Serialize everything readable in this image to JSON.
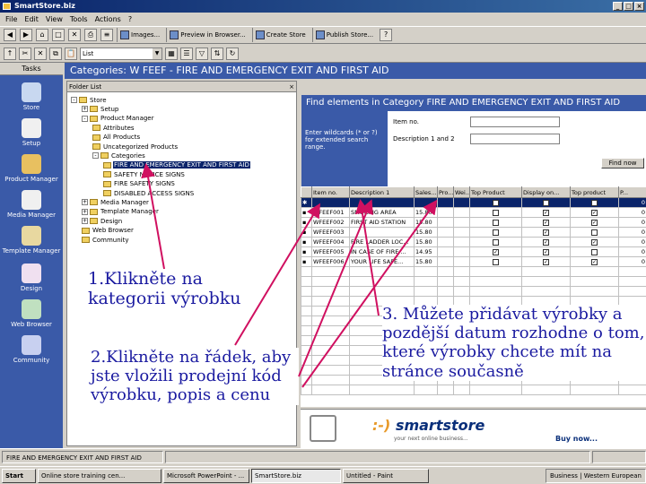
{
  "window": {
    "title": "SmartStore.biz",
    "buttons": [
      "_",
      "□",
      "×"
    ]
  },
  "menu": [
    "File",
    "Edit",
    "View",
    "Tools",
    "Actions",
    "?"
  ],
  "toolbar1": [
    {
      "label": "Images...",
      "icon": "images-icon"
    },
    {
      "label": "Preview in Browser...",
      "icon": "preview-icon"
    },
    {
      "label": "Create Store",
      "icon": "create-store-icon"
    },
    {
      "label": "Publish Store...",
      "icon": "publish-icon"
    }
  ],
  "toolbar2": {
    "combo_value": "List"
  },
  "tasks": {
    "header": "Tasks",
    "items": [
      {
        "label": "Store",
        "color": "#c8d8f0"
      },
      {
        "label": "Setup",
        "color": "#f0f0f0"
      },
      {
        "label": "Product Manager",
        "color": "#e8c060"
      },
      {
        "label": "Media Manager",
        "color": "#f0f0f0"
      },
      {
        "label": "Template Manager",
        "color": "#e8d8a0"
      },
      {
        "label": "Design",
        "color": "#f0e0f0"
      },
      {
        "label": "Web Browser",
        "color": "#c0e0c0"
      },
      {
        "label": "Community",
        "color": "#c8d0f0"
      }
    ]
  },
  "content_title": "Categories: W FEEF - FIRE AND EMERGENCY EXIT AND FIRST AID",
  "tree": {
    "header": "Folder List",
    "close": "×",
    "nodes": [
      {
        "label": "Store",
        "indent": 0,
        "exp": "-"
      },
      {
        "label": "Setup",
        "indent": 1,
        "exp": "+"
      },
      {
        "label": "Product Manager",
        "indent": 1,
        "exp": "-"
      },
      {
        "label": "Attributes",
        "indent": 2,
        "exp": ""
      },
      {
        "label": "All Products",
        "indent": 2,
        "exp": ""
      },
      {
        "label": "Uncategorized Products",
        "indent": 2,
        "exp": ""
      },
      {
        "label": "Categories",
        "indent": 2,
        "exp": "-"
      },
      {
        "label": "FIRE AND EMERGENCY EXIT AND FIRST AID",
        "indent": 3,
        "exp": "",
        "selected": true
      },
      {
        "label": "SAFETY NOTICE SIGNS",
        "indent": 3,
        "exp": ""
      },
      {
        "label": "FIRE SAFETY SIGNS",
        "indent": 3,
        "exp": ""
      },
      {
        "label": "DISABLED ACCESS SIGNS",
        "indent": 3,
        "exp": ""
      },
      {
        "label": "Media Manager",
        "indent": 1,
        "exp": "+"
      },
      {
        "label": "Template Manager",
        "indent": 1,
        "exp": "+"
      },
      {
        "label": "Design",
        "indent": 1,
        "exp": "+"
      },
      {
        "label": "Web Browser",
        "indent": 1,
        "exp": ""
      },
      {
        "label": "Community",
        "indent": 1,
        "exp": ""
      }
    ]
  },
  "find": {
    "title": "Find elements in Category FIRE AND EMERGENCY EXIT AND FIRST AID",
    "hint": "Enter wildcards (* or ?) for extended search range.",
    "field1_label": "Item no.",
    "field2_label": "Description 1 and 2",
    "button": "Find now"
  },
  "grid": {
    "headers": [
      "",
      "Item no.",
      "Description 1",
      "Sales...",
      "Pro...",
      "Wei...",
      "Top Product",
      "Display on...",
      "Top product",
      "P..."
    ],
    "rows": [
      {
        "item": "",
        "desc": "",
        "price": "",
        "p2": "",
        "w": "",
        "c1": false,
        "c2": false,
        "c3": false,
        "last": "0",
        "new": true
      },
      {
        "item": "WFEEF001",
        "desc": "SMOKING AREA",
        "price": "15.80",
        "p2": "",
        "w": "",
        "c1": false,
        "c2": true,
        "c3": true,
        "last": "0"
      },
      {
        "item": "WFEEF002",
        "desc": "FIRST AID STATION",
        "price": "15.80",
        "p2": "",
        "w": "",
        "c1": false,
        "c2": true,
        "c3": true,
        "last": "0"
      },
      {
        "item": "WFEEF003",
        "desc": "",
        "price": "15.80",
        "p2": "",
        "w": "",
        "c1": false,
        "c2": true,
        "c3": false,
        "last": "0"
      },
      {
        "item": "WFEEF004",
        "desc": "FIRE LADDER LOC...",
        "price": "15.80",
        "p2": "",
        "w": "",
        "c1": false,
        "c2": true,
        "c3": true,
        "last": "0"
      },
      {
        "item": "WFEEF005",
        "desc": "IN CASE OF FIRE ...",
        "price": "14.95",
        "p2": "",
        "w": "",
        "c1": true,
        "c2": true,
        "c3": false,
        "last": "0"
      },
      {
        "item": "WFEEF006",
        "desc": "YOUR LIFE SAFE...",
        "price": "15.80",
        "p2": "",
        "w": "",
        "c1": false,
        "c2": true,
        "c3": true,
        "last": "0"
      }
    ],
    "empty_rows": 13
  },
  "banner": {
    "logo_dots": ":-)",
    "logo": "smartstore",
    "tagline": "your next online business...",
    "buy": "Buy now..."
  },
  "statusbar": [
    "FIRE AND EMERGENCY EXIT AND FIRST AID",
    "",
    ""
  ],
  "taskbar": {
    "start": "Start",
    "items": [
      "Online store training cen...",
      "Microsoft PowerPoint - ...",
      "SmartStore.biz",
      "Untitled - Paint"
    ],
    "active": 2,
    "tray": [
      "Business",
      "Western European"
    ]
  },
  "annotations": {
    "a1": "1.Klikněte na kategorii výrobku",
    "a2": "2.Klikněte na řádek, aby jste vložili prodejní kód výrobku, popis a cenu",
    "a3": "3. Můžete přidávat výrobky a pozdější datum rozhodne o tom, které výrobky chcete mít na stránce současně"
  },
  "colors": {
    "panel_blue": "#3a5aa8",
    "selection": "#0a246a",
    "arrow": "#d01060",
    "annotation_text": "#1a1aa0"
  }
}
